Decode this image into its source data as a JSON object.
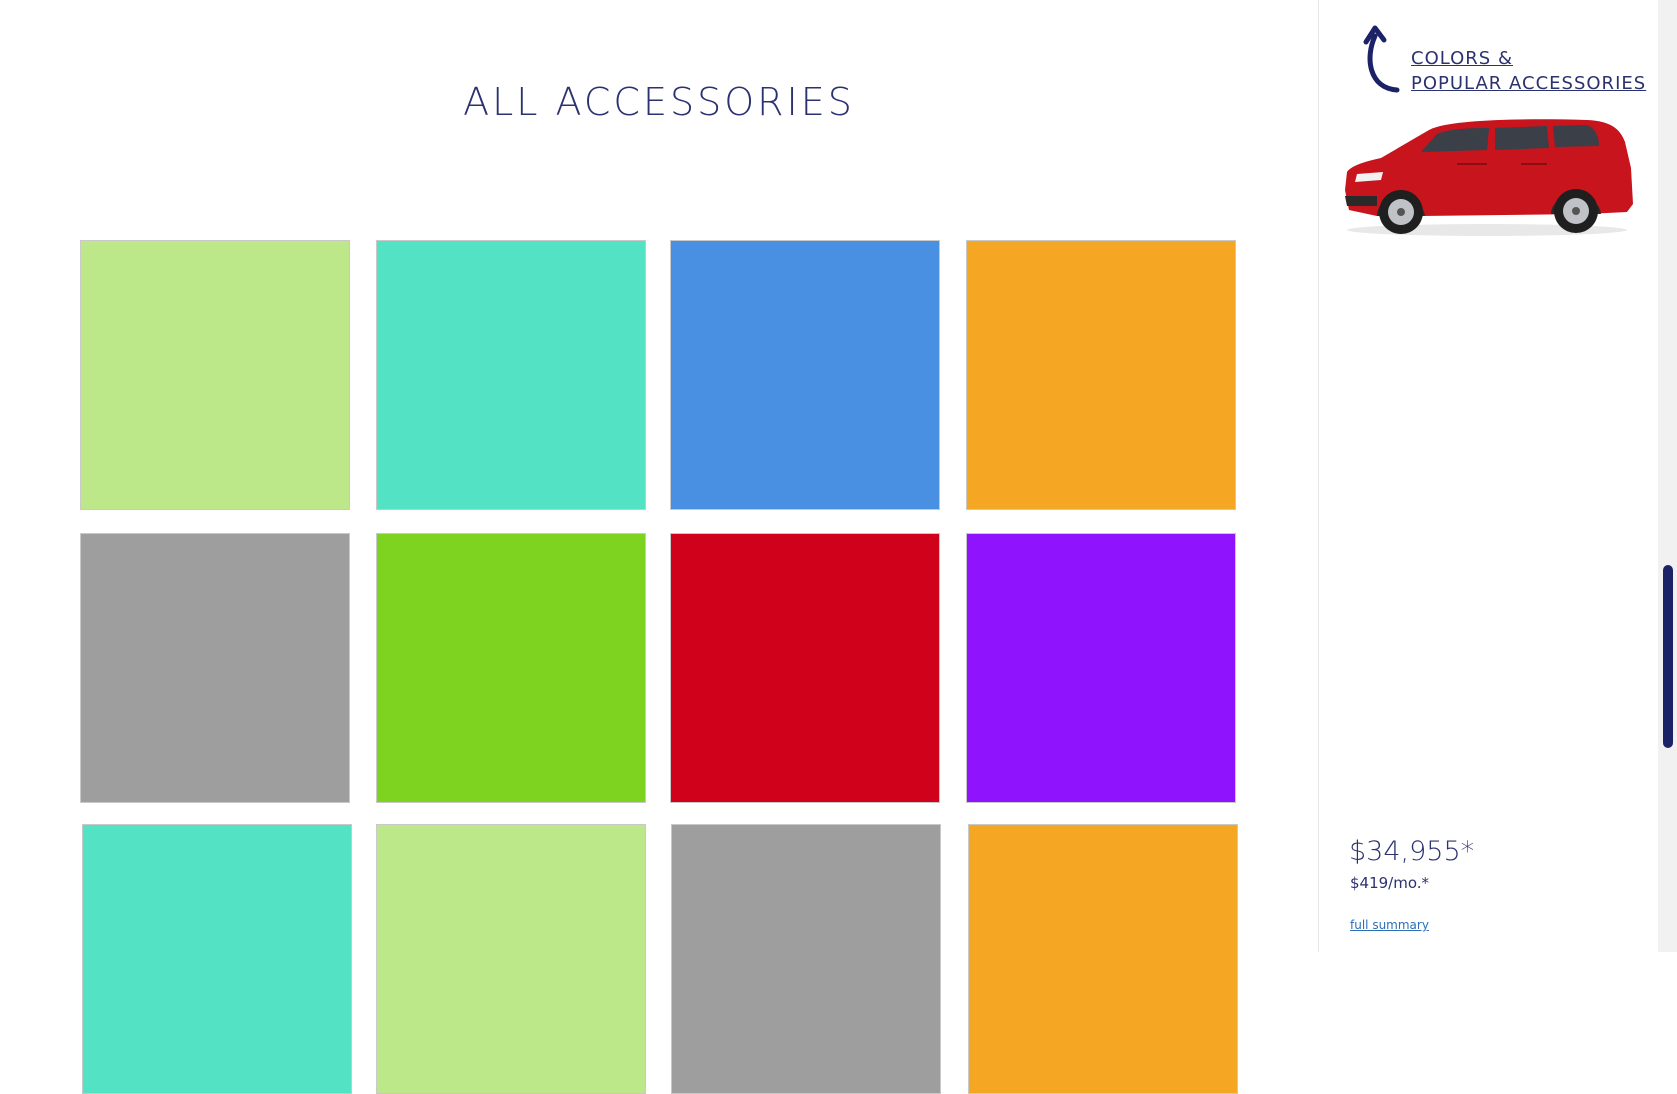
{
  "main": {
    "title": "ALL ACCESSORIES",
    "tiles": [
      {
        "color": "#bde88a"
      },
      {
        "color": "#53e2c3"
      },
      {
        "color": "#4a90e2"
      },
      {
        "color": "#f5a623"
      },
      {
        "color": "#9e9e9e"
      },
      {
        "color": "#7ed321"
      },
      {
        "color": "#d0021b"
      },
      {
        "color": "#9013fe"
      },
      {
        "color": "#53e2c3"
      },
      {
        "color": "#bde88a"
      },
      {
        "color": "#9e9e9e"
      },
      {
        "color": "#f5a623"
      }
    ]
  },
  "sidebar": {
    "back_link_line1": "COLORS &",
    "back_link_line2": "POPULAR ACCESSORIES",
    "back_icon": "curved-back-arrow-icon",
    "car_image": "red-suv",
    "price": "$34,955*",
    "price_monthly": "$419/mo.*",
    "summary_link": "full summary"
  },
  "colors": {
    "brand_navy": "#2c3270",
    "link_blue": "#2c6fb5",
    "car_red": "#c8141c",
    "scroll_thumb": "#1c2266"
  }
}
